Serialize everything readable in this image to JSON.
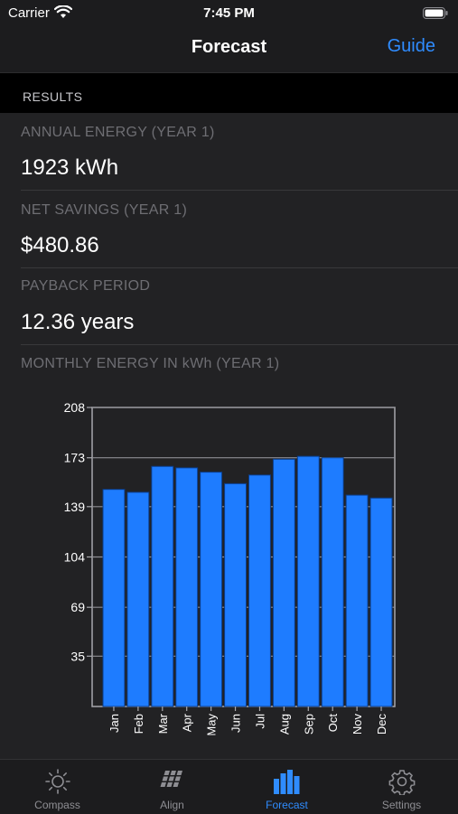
{
  "status": {
    "carrier": "Carrier",
    "time": "7:45 PM"
  },
  "nav": {
    "title": "Forecast",
    "guide": "Guide"
  },
  "section": {
    "header": "RESULTS"
  },
  "results": [
    {
      "label": "ANNUAL ENERGY (YEAR 1)",
      "value": "1923 kWh"
    },
    {
      "label": "NET SAVINGS (YEAR 1)",
      "value": "$480.86"
    },
    {
      "label": "PAYBACK PERIOD",
      "value": "12.36 years"
    }
  ],
  "chart_label": "MONTHLY ENERGY IN kWh (YEAR 1)",
  "chart_data": {
    "type": "bar",
    "categories": [
      "Jan",
      "Feb",
      "Mar",
      "Apr",
      "May",
      "Jun",
      "Jul",
      "Aug",
      "Sep",
      "Oct",
      "Nov",
      "Dec"
    ],
    "values": [
      151,
      149,
      167,
      166,
      163,
      155,
      161,
      172,
      174,
      173,
      147,
      145
    ],
    "yticks": [
      "35",
      "69",
      "104",
      "139",
      "173",
      "208"
    ],
    "ytick_values": [
      35,
      69,
      104,
      139,
      173,
      208
    ],
    "ylim": [
      0,
      208
    ],
    "grid": true,
    "colors": {
      "bar": "#1e7cff",
      "bar_edge": "#0b3d8a",
      "axis": "#a8a8ad",
      "grid": "#8e8e93",
      "tick_text": "#ffffff"
    }
  },
  "tabs": [
    {
      "label": "Compass",
      "icon": "sun-icon",
      "active": false
    },
    {
      "label": "Align",
      "icon": "solar-panel-icon",
      "active": false
    },
    {
      "label": "Forecast",
      "icon": "bar-chart-icon",
      "active": true
    },
    {
      "label": "Settings",
      "icon": "gear-icon",
      "active": false
    }
  ],
  "colors": {
    "accent": "#2f8cff",
    "background": "#222224",
    "header": "#000000"
  }
}
